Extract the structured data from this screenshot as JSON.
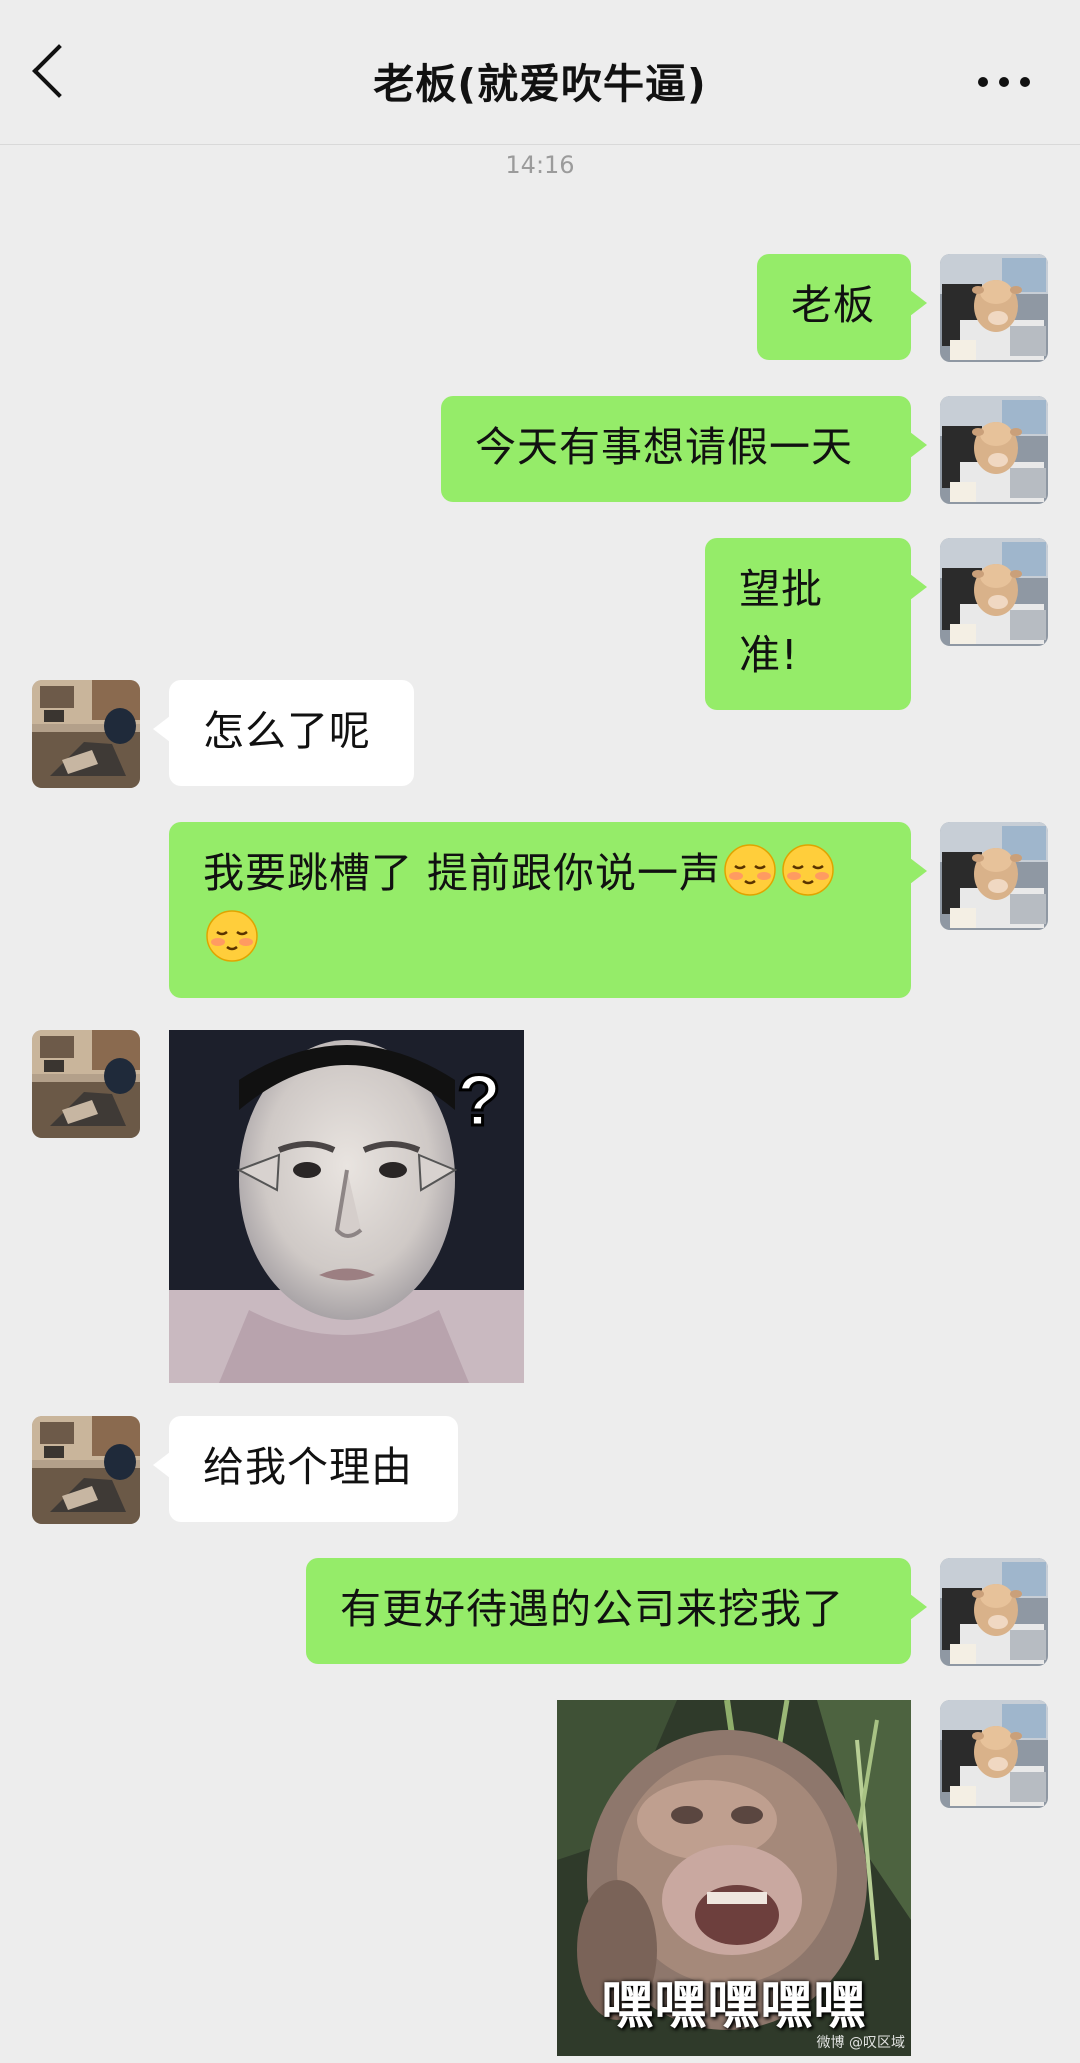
{
  "header": {
    "title": "老板(就爱吹牛逼)",
    "back_icon": "chevron-left-icon",
    "more_icon": "more-dots-icon"
  },
  "timestamp": "14:16",
  "colors": {
    "background": "#ededed",
    "my_bubble": "#95ec69",
    "other_bubble": "#ffffff"
  },
  "messages": [
    {
      "from": "me",
      "type": "text",
      "text": "老板"
    },
    {
      "from": "me",
      "type": "text",
      "text": "今天有事想请假一天"
    },
    {
      "from": "me",
      "type": "text",
      "text": "望批准!"
    },
    {
      "from": "other",
      "type": "text",
      "text": "怎么了呢"
    },
    {
      "from": "me",
      "type": "text",
      "text": "我要跳槽了 提前跟你说一声",
      "emoji": "blush-emoji"
    },
    {
      "from": "other",
      "type": "sticker",
      "mark": "?"
    },
    {
      "from": "other",
      "type": "text",
      "text": "给我个理由"
    },
    {
      "from": "me",
      "type": "text",
      "text": "有更好待遇的公司来挖我了"
    },
    {
      "from": "me",
      "type": "sticker",
      "caption": "嘿嘿嘿嘿嘿",
      "watermark": "微博 @叹区域"
    }
  ]
}
